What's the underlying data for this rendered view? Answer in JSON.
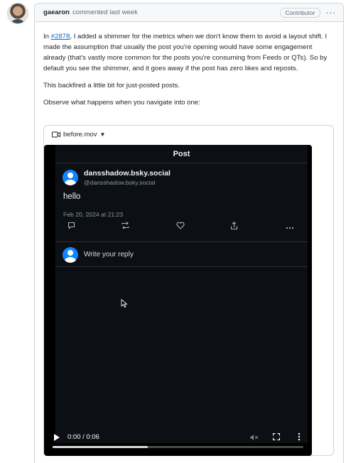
{
  "comment": {
    "author": "gaearon",
    "action": "commented last week",
    "badge": "Contributor",
    "menu": "···",
    "p1_prefix": "In ",
    "p1_link": "#2878",
    "p1_suffix": ", I added a shimmer for the metrics when we don't know them to avoid a layout shift. I made the assumption that usually the post you're opening would have some engagement already (that's vastly more common for the posts you're consuming from Feeds or QTs). So by default you see the shimmer, and it goes away if the post has zero likes and reposts.",
    "p2": "This backfired a little bit for just-posted posts.",
    "p3": "Observe what happens when you navigate into one:"
  },
  "video": {
    "file_name": "before.mov",
    "icon": "video-camera-icon",
    "time": "0:00 / 0:06",
    "progress": 0.38,
    "app": {
      "title": "Post",
      "display_name": "dansshadow.bsky.social",
      "handle": "@dansshadow.bsky.social",
      "text": "hello",
      "date": "Feb 20, 2024 at 21:23",
      "actions": [
        "reply-icon",
        "repost-icon",
        "like-icon",
        "share-icon",
        "more-icon"
      ],
      "reply_placeholder": "Write your reply"
    }
  }
}
